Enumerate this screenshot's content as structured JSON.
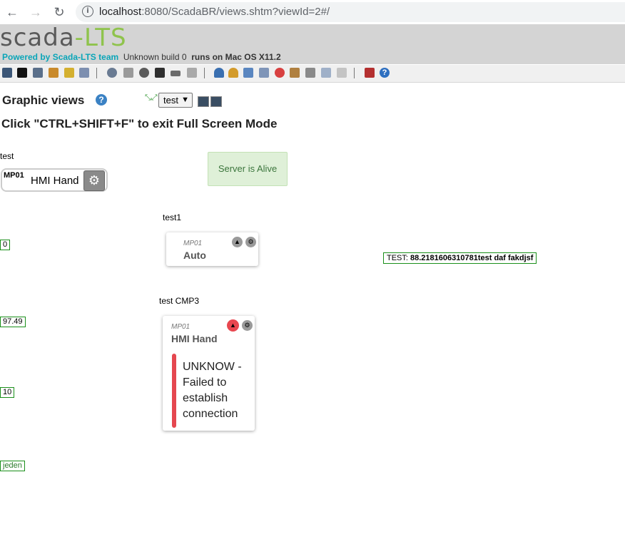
{
  "browser": {
    "url_host": "localhost",
    "url_rest": ":8080/ScadaBR/views.shtm?viewId=2#/"
  },
  "header": {
    "logo_left": "scada",
    "logo_dash": "-",
    "logo_right": "LTS",
    "powered": "Powered by Scada-LTS team",
    "build": "Unknown build 0",
    "runs_on": "runs on Mac OS X11.2"
  },
  "toolbar": {
    "icons": [
      "watch-list-icon",
      "graphic-views-icon",
      "events-icon",
      "reports-icon",
      "event-handlers-icon",
      "data-sources-icon",
      "publishers-icon",
      "scheduled-events-icon",
      "compound-events-icon",
      "point-links-icon",
      "scripting-icon",
      "users-icon",
      "user-profiles-icon",
      "point-hierarchy-icon",
      "mailing-lists-icon",
      "maintenance-icon",
      "system-settings-icon",
      "configuration-icon",
      "sql-icon",
      "import-export-icon",
      "logout-icon",
      "help-icon"
    ]
  },
  "page": {
    "title": "Graphic views",
    "help": "?",
    "selected_view": "test",
    "notice": "Click \"CTRL+SHIFT+F\" to exit Full Screen Mode"
  },
  "widgets": {
    "toggle": {
      "label": "test",
      "code": "MP01",
      "value": "HMI Hand"
    },
    "server": {
      "text": "Server is Alive"
    },
    "card1": {
      "label": "test1",
      "code": "MP01",
      "value": "Auto"
    },
    "card2": {
      "label": "test CMP3",
      "code": "MP01",
      "value": "HMI Hand",
      "error": "UNKNOW - Failed to establish connection"
    },
    "values": [
      "0",
      "97.49",
      "10",
      "jeden"
    ],
    "test_value": {
      "prefix": "TEST:",
      "value": "88.2181606310781test daf fakdjsf"
    }
  }
}
